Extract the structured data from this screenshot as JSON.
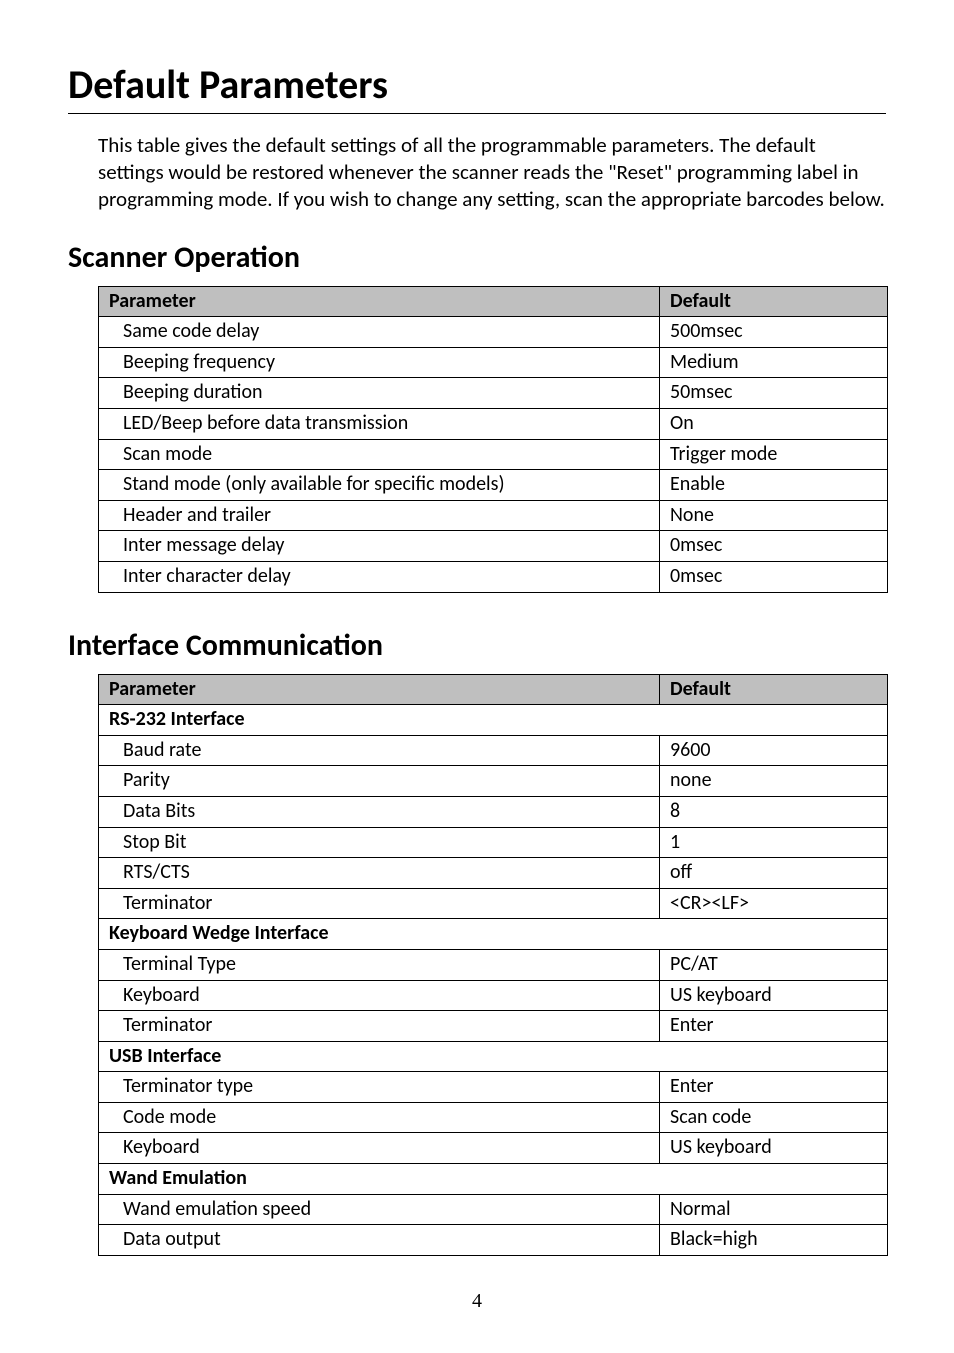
{
  "title": "Default Parameters",
  "intro": "This table gives the default settings of all the programmable parameters. The default settings would be restored whenever the scanner reads the \"Reset\" programming label in programming mode. If you wish to change any setting, scan the appropriate barcodes below.",
  "sections": {
    "scanner_operation": {
      "heading": "Scanner Operation",
      "header_param": "Parameter",
      "header_default": "Default",
      "rows": [
        {
          "param": "Same code delay",
          "default": "500msec"
        },
        {
          "param": "Beeping frequency",
          "default": "Medium"
        },
        {
          "param": "Beeping duration",
          "default": "50msec"
        },
        {
          "param": "LED/Beep before data transmission",
          "default": "On"
        },
        {
          "param": "Scan mode",
          "default": "Trigger mode"
        },
        {
          "param": "Stand mode (only available for specific models)",
          "default": "Enable"
        },
        {
          "param": "Header and trailer",
          "default": "None"
        },
        {
          "param": "Inter message delay",
          "default": "0msec"
        },
        {
          "param": "Inter character delay",
          "default": "0msec"
        }
      ]
    },
    "interface_communication": {
      "heading": "Interface Communication",
      "header_param": "Parameter",
      "header_default": "Default",
      "rows": [
        {
          "subhead": "RS-232 Interface"
        },
        {
          "param": "Baud rate",
          "default": "9600"
        },
        {
          "param": "Parity",
          "default": "none"
        },
        {
          "param": "Data Bits",
          "default": "8"
        },
        {
          "param": "Stop Bit",
          "default": "1"
        },
        {
          "param": "RTS/CTS",
          "default": "off"
        },
        {
          "param": "Terminator",
          "default": "<CR><LF>"
        },
        {
          "subhead": "Keyboard Wedge Interface"
        },
        {
          "param": "Terminal Type",
          "default": "PC/AT"
        },
        {
          "param": "Keyboard",
          "default": "US keyboard"
        },
        {
          "param": "Terminator",
          "default": "Enter"
        },
        {
          "subhead": "USB Interface"
        },
        {
          "param": "Terminator type",
          "default": "Enter"
        },
        {
          "param": "Code mode",
          "default": "Scan code"
        },
        {
          "param": "Keyboard",
          "default": "US keyboard"
        },
        {
          "subhead": "Wand Emulation"
        },
        {
          "param": "Wand emulation speed",
          "default": "Normal"
        },
        {
          "param": "Data output",
          "default": "Black=high"
        }
      ]
    }
  },
  "page_number": "4"
}
